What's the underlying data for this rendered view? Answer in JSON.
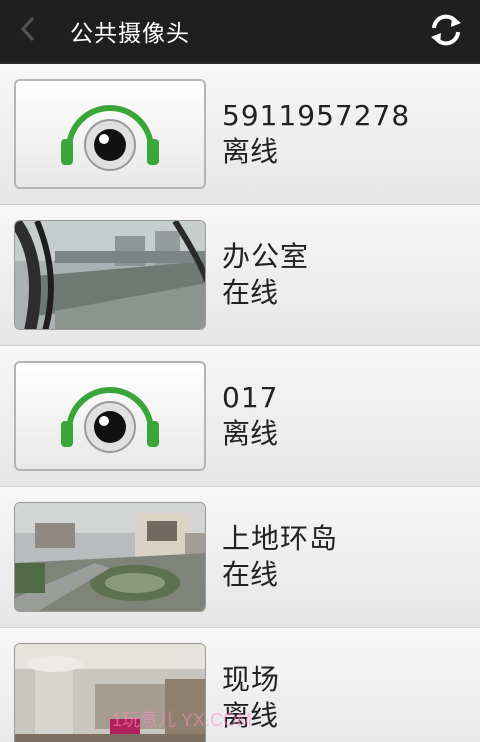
{
  "header": {
    "title": "公共摄像头",
    "back_icon": "chevron-left-icon",
    "refresh_icon": "refresh-icon"
  },
  "cameras": [
    {
      "name": "5911957278",
      "status": "离线",
      "thumbnail": "headphone-eye-logo"
    },
    {
      "name": "办公室",
      "status": "在线",
      "thumbnail": "photo-office-window-view"
    },
    {
      "name": "017",
      "status": "离线",
      "thumbnail": "headphone-eye-logo"
    },
    {
      "name": "上地环岛",
      "status": "在线",
      "thumbnail": "photo-roundabout-aerial"
    },
    {
      "name": "现场",
      "status": "离线",
      "thumbnail": "photo-indoor-lobby"
    }
  ],
  "watermark": "1玩意儿 YX.COM",
  "colors": {
    "header_bg": "#1f1f1f",
    "logo_green": "#3aa63a"
  }
}
